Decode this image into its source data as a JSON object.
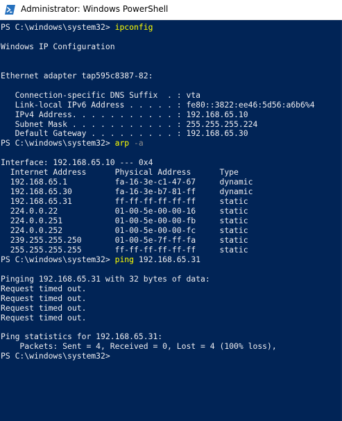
{
  "window": {
    "title": "Administrator: Windows PowerShell",
    "icon": "powershell-icon"
  },
  "colors": {
    "background": "#012456",
    "text": "#eeedf0",
    "command": "#ffff00",
    "parameter": "#8a8a8a"
  },
  "console": {
    "lines": [
      {
        "prompt": "PS C:\\windows\\system32> ",
        "cmd": "ipconfig"
      },
      {
        "text": ""
      },
      {
        "text": "Windows IP Configuration"
      },
      {
        "text": ""
      },
      {
        "text": ""
      },
      {
        "text": "Ethernet adapter tap595c8387-82:"
      },
      {
        "text": ""
      },
      {
        "text": "   Connection-specific DNS Suffix  . : vta"
      },
      {
        "text": "   Link-local IPv6 Address . . . . . : fe80::3822:ee46:5d56:a6b6%4"
      },
      {
        "text": "   IPv4 Address. . . . . . . . . . . : 192.168.65.10"
      },
      {
        "text": "   Subnet Mask . . . . . . . . . . . : 255.255.255.224"
      },
      {
        "text": "   Default Gateway . . . . . . . . . : 192.168.65.30"
      },
      {
        "prompt": "PS C:\\windows\\system32> ",
        "cmd": "arp",
        "param": " -a"
      },
      {
        "text": ""
      },
      {
        "text": "Interface: 192.168.65.10 --- 0x4"
      },
      {
        "text": "  Internet Address      Physical Address      Type"
      },
      {
        "text": "  192.168.65.1          fa-16-3e-c1-47-67     dynamic"
      },
      {
        "text": "  192.168.65.30         fa-16-3e-b7-81-ff     dynamic"
      },
      {
        "text": "  192.168.65.31         ff-ff-ff-ff-ff-ff     static"
      },
      {
        "text": "  224.0.0.22            01-00-5e-00-00-16     static"
      },
      {
        "text": "  224.0.0.251           01-00-5e-00-00-fb     static"
      },
      {
        "text": "  224.0.0.252           01-00-5e-00-00-fc     static"
      },
      {
        "text": "  239.255.255.250       01-00-5e-7f-ff-fa     static"
      },
      {
        "text": "  255.255.255.255       ff-ff-ff-ff-ff-ff     static"
      },
      {
        "prompt": "PS C:\\windows\\system32> ",
        "cmd": "ping",
        "arg": " 192.168.65.31"
      },
      {
        "text": ""
      },
      {
        "text": "Pinging 192.168.65.31 with 32 bytes of data:"
      },
      {
        "text": "Request timed out."
      },
      {
        "text": "Request timed out."
      },
      {
        "text": "Request timed out."
      },
      {
        "text": "Request timed out."
      },
      {
        "text": ""
      },
      {
        "text": "Ping statistics for 192.168.65.31:"
      },
      {
        "text": "    Packets: Sent = 4, Received = 0, Lost = 4 (100% loss),"
      },
      {
        "prompt": "PS C:\\windows\\system32> ",
        "text": ""
      }
    ]
  }
}
